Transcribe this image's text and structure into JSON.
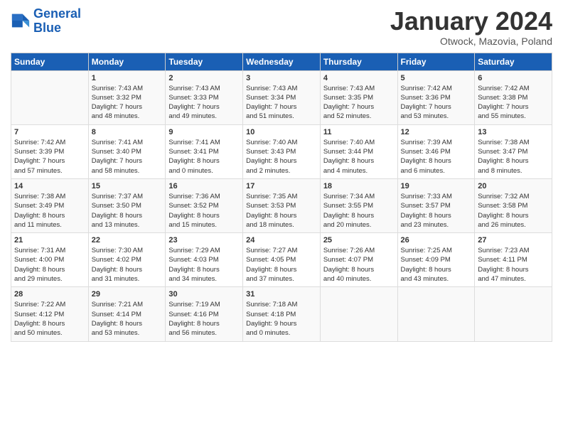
{
  "logo": {
    "line1": "General",
    "line2": "Blue"
  },
  "title": "January 2024",
  "subtitle": "Otwock, Mazovia, Poland",
  "days_of_week": [
    "Sunday",
    "Monday",
    "Tuesday",
    "Wednesday",
    "Thursday",
    "Friday",
    "Saturday"
  ],
  "weeks": [
    [
      {
        "day": "",
        "content": ""
      },
      {
        "day": "1",
        "content": "Sunrise: 7:43 AM\nSunset: 3:32 PM\nDaylight: 7 hours\nand 48 minutes."
      },
      {
        "day": "2",
        "content": "Sunrise: 7:43 AM\nSunset: 3:33 PM\nDaylight: 7 hours\nand 49 minutes."
      },
      {
        "day": "3",
        "content": "Sunrise: 7:43 AM\nSunset: 3:34 PM\nDaylight: 7 hours\nand 51 minutes."
      },
      {
        "day": "4",
        "content": "Sunrise: 7:43 AM\nSunset: 3:35 PM\nDaylight: 7 hours\nand 52 minutes."
      },
      {
        "day": "5",
        "content": "Sunrise: 7:42 AM\nSunset: 3:36 PM\nDaylight: 7 hours\nand 53 minutes."
      },
      {
        "day": "6",
        "content": "Sunrise: 7:42 AM\nSunset: 3:38 PM\nDaylight: 7 hours\nand 55 minutes."
      }
    ],
    [
      {
        "day": "7",
        "content": "Sunrise: 7:42 AM\nSunset: 3:39 PM\nDaylight: 7 hours\nand 57 minutes."
      },
      {
        "day": "8",
        "content": "Sunrise: 7:41 AM\nSunset: 3:40 PM\nDaylight: 7 hours\nand 58 minutes."
      },
      {
        "day": "9",
        "content": "Sunrise: 7:41 AM\nSunset: 3:41 PM\nDaylight: 8 hours\nand 0 minutes."
      },
      {
        "day": "10",
        "content": "Sunrise: 7:40 AM\nSunset: 3:43 PM\nDaylight: 8 hours\nand 2 minutes."
      },
      {
        "day": "11",
        "content": "Sunrise: 7:40 AM\nSunset: 3:44 PM\nDaylight: 8 hours\nand 4 minutes."
      },
      {
        "day": "12",
        "content": "Sunrise: 7:39 AM\nSunset: 3:46 PM\nDaylight: 8 hours\nand 6 minutes."
      },
      {
        "day": "13",
        "content": "Sunrise: 7:38 AM\nSunset: 3:47 PM\nDaylight: 8 hours\nand 8 minutes."
      }
    ],
    [
      {
        "day": "14",
        "content": "Sunrise: 7:38 AM\nSunset: 3:49 PM\nDaylight: 8 hours\nand 11 minutes."
      },
      {
        "day": "15",
        "content": "Sunrise: 7:37 AM\nSunset: 3:50 PM\nDaylight: 8 hours\nand 13 minutes."
      },
      {
        "day": "16",
        "content": "Sunrise: 7:36 AM\nSunset: 3:52 PM\nDaylight: 8 hours\nand 15 minutes."
      },
      {
        "day": "17",
        "content": "Sunrise: 7:35 AM\nSunset: 3:53 PM\nDaylight: 8 hours\nand 18 minutes."
      },
      {
        "day": "18",
        "content": "Sunrise: 7:34 AM\nSunset: 3:55 PM\nDaylight: 8 hours\nand 20 minutes."
      },
      {
        "day": "19",
        "content": "Sunrise: 7:33 AM\nSunset: 3:57 PM\nDaylight: 8 hours\nand 23 minutes."
      },
      {
        "day": "20",
        "content": "Sunrise: 7:32 AM\nSunset: 3:58 PM\nDaylight: 8 hours\nand 26 minutes."
      }
    ],
    [
      {
        "day": "21",
        "content": "Sunrise: 7:31 AM\nSunset: 4:00 PM\nDaylight: 8 hours\nand 29 minutes."
      },
      {
        "day": "22",
        "content": "Sunrise: 7:30 AM\nSunset: 4:02 PM\nDaylight: 8 hours\nand 31 minutes."
      },
      {
        "day": "23",
        "content": "Sunrise: 7:29 AM\nSunset: 4:03 PM\nDaylight: 8 hours\nand 34 minutes."
      },
      {
        "day": "24",
        "content": "Sunrise: 7:27 AM\nSunset: 4:05 PM\nDaylight: 8 hours\nand 37 minutes."
      },
      {
        "day": "25",
        "content": "Sunrise: 7:26 AM\nSunset: 4:07 PM\nDaylight: 8 hours\nand 40 minutes."
      },
      {
        "day": "26",
        "content": "Sunrise: 7:25 AM\nSunset: 4:09 PM\nDaylight: 8 hours\nand 43 minutes."
      },
      {
        "day": "27",
        "content": "Sunrise: 7:23 AM\nSunset: 4:11 PM\nDaylight: 8 hours\nand 47 minutes."
      }
    ],
    [
      {
        "day": "28",
        "content": "Sunrise: 7:22 AM\nSunset: 4:12 PM\nDaylight: 8 hours\nand 50 minutes."
      },
      {
        "day": "29",
        "content": "Sunrise: 7:21 AM\nSunset: 4:14 PM\nDaylight: 8 hours\nand 53 minutes."
      },
      {
        "day": "30",
        "content": "Sunrise: 7:19 AM\nSunset: 4:16 PM\nDaylight: 8 hours\nand 56 minutes."
      },
      {
        "day": "31",
        "content": "Sunrise: 7:18 AM\nSunset: 4:18 PM\nDaylight: 9 hours\nand 0 minutes."
      },
      {
        "day": "",
        "content": ""
      },
      {
        "day": "",
        "content": ""
      },
      {
        "day": "",
        "content": ""
      }
    ]
  ]
}
